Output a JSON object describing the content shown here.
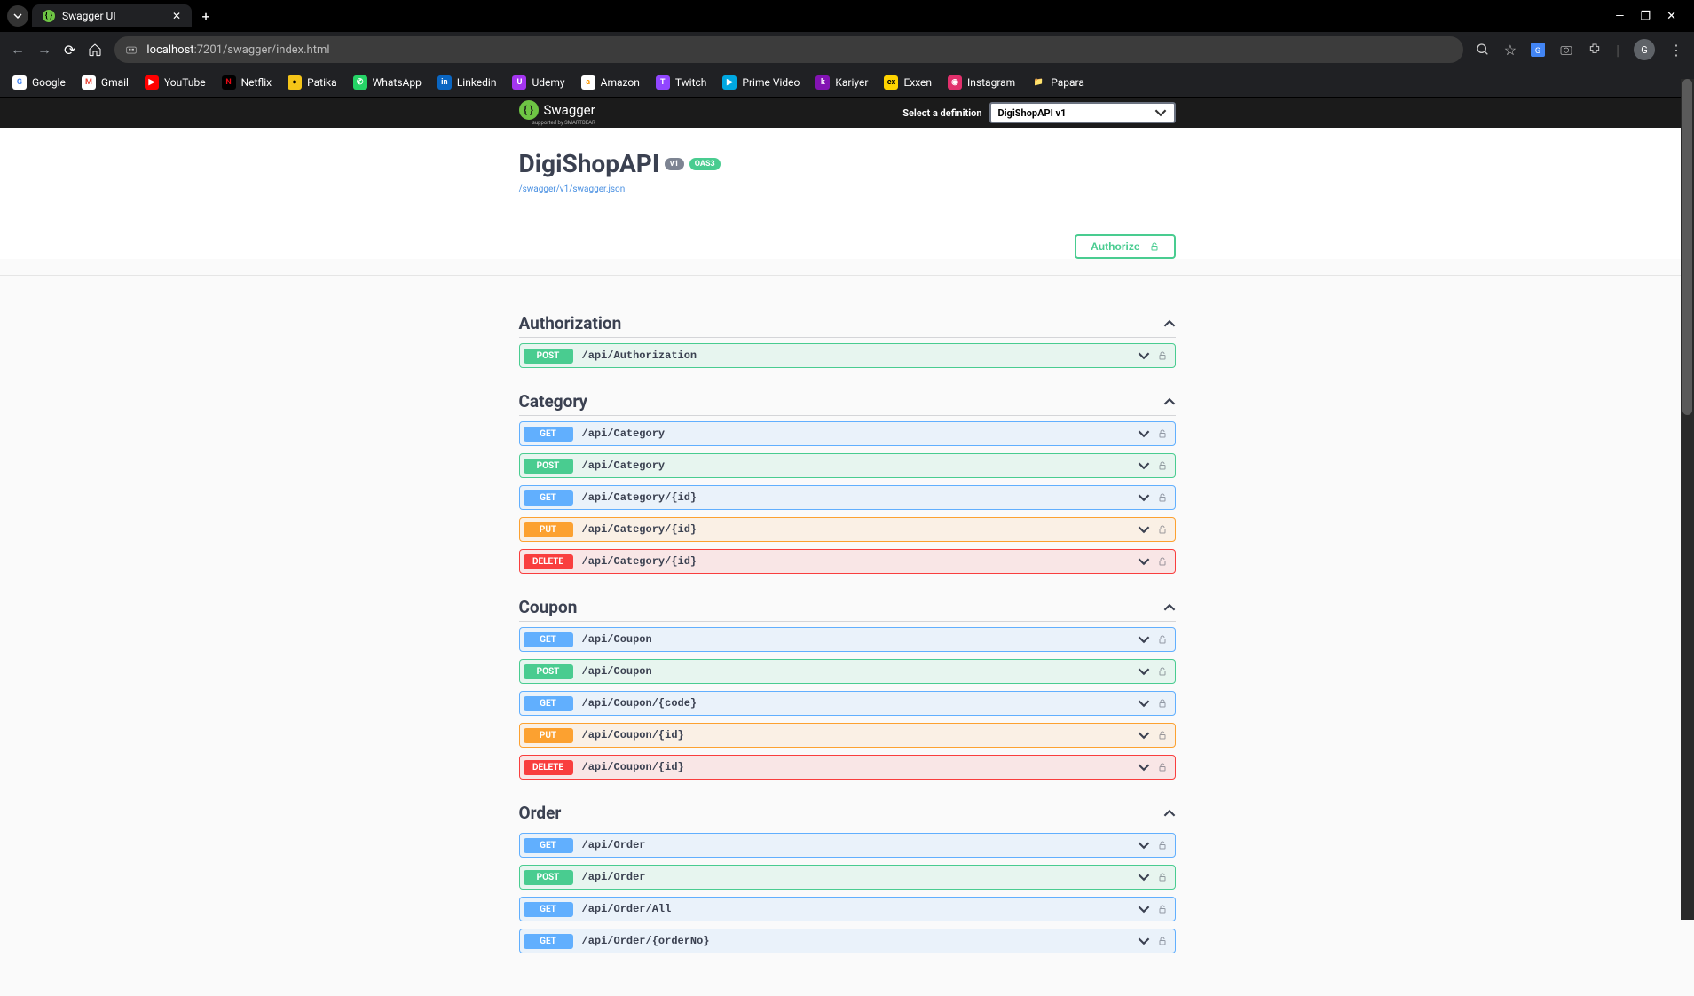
{
  "browser": {
    "tab_title": "Swagger UI",
    "url_host": "localhost",
    "url_port": ":7201",
    "url_path": "/swagger/index.html",
    "bookmarks": [
      {
        "label": "Google",
        "bg": "#fff",
        "fg": "#4285F4",
        "txt": "G"
      },
      {
        "label": "Gmail",
        "bg": "#fff",
        "fg": "#ea4335",
        "txt": "M"
      },
      {
        "label": "YouTube",
        "bg": "#ff0000",
        "fg": "#fff",
        "txt": "▶"
      },
      {
        "label": "Netflix",
        "bg": "#000",
        "fg": "#e50914",
        "txt": "N"
      },
      {
        "label": "Patika",
        "bg": "#f5c518",
        "fg": "#000",
        "txt": "●"
      },
      {
        "label": "WhatsApp",
        "bg": "#25d366",
        "fg": "#fff",
        "txt": "✆"
      },
      {
        "label": "Linkedin",
        "bg": "#0a66c2",
        "fg": "#fff",
        "txt": "in"
      },
      {
        "label": "Udemy",
        "bg": "#a435f0",
        "fg": "#fff",
        "txt": "U"
      },
      {
        "label": "Amazon",
        "bg": "#fff",
        "fg": "#ff9900",
        "txt": "a"
      },
      {
        "label": "Twitch",
        "bg": "#9146ff",
        "fg": "#fff",
        "txt": "T"
      },
      {
        "label": "Prime Video",
        "bg": "#00a8e1",
        "fg": "#fff",
        "txt": "▶"
      },
      {
        "label": "Kariyer",
        "bg": "#8313b3",
        "fg": "#fff",
        "txt": "k"
      },
      {
        "label": "Exxen",
        "bg": "#ffd400",
        "fg": "#000",
        "txt": "ex"
      },
      {
        "label": "Instagram",
        "bg": "#e1306c",
        "fg": "#fff",
        "txt": "◉"
      },
      {
        "label": "Papara",
        "bg": "transparent",
        "fg": "#aaa",
        "txt": "📁"
      }
    ],
    "avatar_letter": "G"
  },
  "swagger": {
    "brand": "Swagger",
    "subbrand": "supported by SMARTBEAR",
    "select_label": "Select a definition",
    "selected_def": "DigiShopAPI v1"
  },
  "api": {
    "title": "DigiShopAPI",
    "version_badge": "v1",
    "oas_badge": "OAS3",
    "spec_link": "/swagger/v1/swagger.json",
    "authorize_label": "Authorize"
  },
  "tags": [
    {
      "name": "Authorization",
      "ops": [
        {
          "method": "POST",
          "path": "/api/Authorization"
        }
      ]
    },
    {
      "name": "Category",
      "ops": [
        {
          "method": "GET",
          "path": "/api/Category"
        },
        {
          "method": "POST",
          "path": "/api/Category"
        },
        {
          "method": "GET",
          "path": "/api/Category/{id}"
        },
        {
          "method": "PUT",
          "path": "/api/Category/{id}"
        },
        {
          "method": "DELETE",
          "path": "/api/Category/{id}"
        }
      ]
    },
    {
      "name": "Coupon",
      "ops": [
        {
          "method": "GET",
          "path": "/api/Coupon"
        },
        {
          "method": "POST",
          "path": "/api/Coupon"
        },
        {
          "method": "GET",
          "path": "/api/Coupon/{code}"
        },
        {
          "method": "PUT",
          "path": "/api/Coupon/{id}"
        },
        {
          "method": "DELETE",
          "path": "/api/Coupon/{id}"
        }
      ]
    },
    {
      "name": "Order",
      "ops": [
        {
          "method": "GET",
          "path": "/api/Order"
        },
        {
          "method": "POST",
          "path": "/api/Order"
        },
        {
          "method": "GET",
          "path": "/api/Order/All"
        },
        {
          "method": "GET",
          "path": "/api/Order/{orderNo}"
        }
      ]
    }
  ]
}
